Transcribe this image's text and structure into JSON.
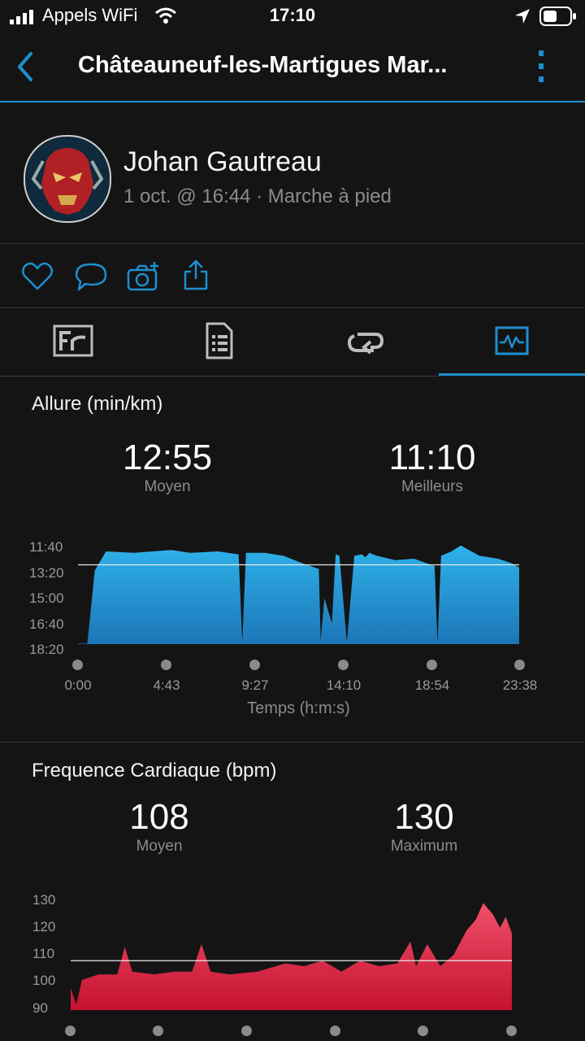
{
  "status_bar": {
    "carrier": "Appels WiFi",
    "time": "17:10"
  },
  "header": {
    "title": "Châteauneuf-les-Martigues Mar..."
  },
  "activity": {
    "user_name": "Johan Gautreau",
    "subtitle": "1 oct. @ 16:44 · Marche à pied"
  },
  "colors": {
    "accent": "#1d8fd0",
    "pace_fill": "#2aa4dc",
    "hr_fill": "#d7243f"
  },
  "pace": {
    "title": "Allure (min/km)",
    "avg_value": "12:55",
    "avg_label": "Moyen",
    "best_value": "11:10",
    "best_label": "Meilleurs",
    "y_ticks": [
      "11:40",
      "13:20",
      "15:00",
      "16:40",
      "18:20"
    ],
    "x_ticks": [
      "0:00",
      "4:43",
      "9:27",
      "14:10",
      "18:54",
      "23:38"
    ],
    "x_title": "Temps (h:m:s)"
  },
  "hr": {
    "title": "Frequence Cardiaque (bpm)",
    "avg_value": "108",
    "avg_label": "Moyen",
    "max_value": "130",
    "max_label": "Maximum",
    "y_ticks": [
      "130",
      "120",
      "110",
      "100",
      "90"
    ]
  },
  "chart_data": [
    {
      "type": "area",
      "title": "Allure (min/km)",
      "xlabel": "Temps (h:m:s)",
      "ylabel": "",
      "y_inverted": true,
      "ylim_minutes": [
        11.667,
        18.333
      ],
      "average_line_minutes": 12.917,
      "x_min": [
        0,
        0.5,
        0.9,
        1.5,
        3,
        5,
        6,
        7.5,
        8.6,
        8.8,
        9.0,
        10,
        11,
        12,
        12.9,
        13.0,
        13.2,
        13.6,
        13.8,
        14.0,
        14.4,
        14.8,
        15.2,
        15.4,
        15.6,
        16.0,
        17.0,
        18.0,
        19.1,
        19.25,
        19.45,
        20.0,
        20.5,
        21.5,
        22.5,
        23.2,
        23.63
      ],
      "y_pace": [
        18.3,
        18.3,
        13.3,
        12.0,
        12.1,
        11.9,
        12.1,
        12.0,
        12.2,
        18.2,
        12.1,
        12.1,
        12.3,
        12.8,
        13.2,
        18.1,
        15.2,
        16.9,
        12.2,
        12.3,
        18.2,
        12.3,
        12.2,
        12.4,
        12.1,
        12.3,
        12.6,
        12.5,
        13.0,
        18.3,
        12.3,
        12.0,
        11.6,
        12.3,
        12.5,
        12.8,
        13.1
      ]
    },
    {
      "type": "area",
      "title": "Frequence Cardiaque (bpm)",
      "xlabel": "",
      "ylabel": "",
      "ylim": [
        90,
        130
      ],
      "average_line": 108,
      "x_min": [
        0,
        0.3,
        0.6,
        1.5,
        2.5,
        2.9,
        3.3,
        4.5,
        5.5,
        6.5,
        7,
        7.5,
        8.5,
        10,
        11.5,
        12.5,
        13.5,
        14.5,
        15.5,
        16.5,
        17.5,
        18.2,
        18.5,
        19.1,
        19.8,
        20.5,
        21.2,
        21.7,
        22.1,
        22.6,
        23.0,
        23.3,
        23.63
      ],
      "y_bpm": [
        98,
        92,
        101,
        103,
        103,
        113,
        104,
        103,
        104,
        104,
        114,
        104,
        103,
        104,
        107,
        106,
        108,
        104,
        108,
        106,
        107,
        115,
        106,
        114,
        106,
        110,
        119,
        123,
        129,
        125,
        120,
        124,
        118
      ]
    }
  ]
}
